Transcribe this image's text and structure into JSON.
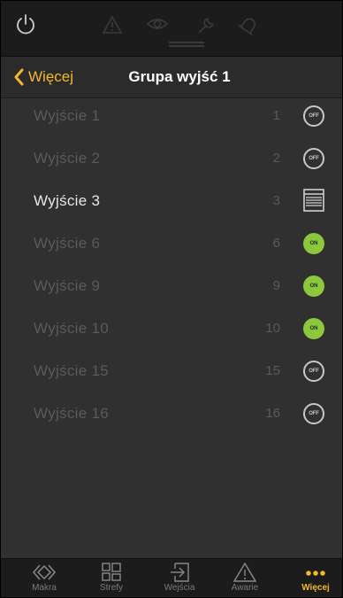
{
  "header": {
    "back_label": "Więcej",
    "title": "Grupa wyjść 1"
  },
  "outputs": [
    {
      "name": "Wyjście  1",
      "number": "1",
      "state": "OFF",
      "icon": "off-badge-icon"
    },
    {
      "name": "Wyjście  2",
      "number": "2",
      "state": "OFF",
      "icon": "off-badge-icon"
    },
    {
      "name": "Wyjście  3",
      "number": "3",
      "state": "",
      "icon": "blind-icon"
    },
    {
      "name": "Wyjście  6",
      "number": "6",
      "state": "ON",
      "icon": "on-badge-icon"
    },
    {
      "name": "Wyjście  9",
      "number": "9",
      "state": "ON",
      "icon": "on-badge-icon"
    },
    {
      "name": "Wyjście 10",
      "number": "10",
      "state": "ON",
      "icon": "on-badge-icon"
    },
    {
      "name": "Wyjście 15",
      "number": "15",
      "state": "OFF",
      "icon": "off-badge-icon"
    },
    {
      "name": "Wyjście 16",
      "number": "16",
      "state": "OFF",
      "icon": "off-badge-icon"
    }
  ],
  "tabs": [
    {
      "label": "Makra",
      "icon": "makra-icon"
    },
    {
      "label": "Strefy",
      "icon": "strefy-icon"
    },
    {
      "label": "Wejścia",
      "icon": "wejscia-icon"
    },
    {
      "label": "Awarie",
      "icon": "awarie-icon"
    },
    {
      "label": "Więcej",
      "icon": "more-dots-icon"
    }
  ],
  "colors": {
    "accent": "#f0b72f",
    "on": "#8dc63f",
    "background": "#303030",
    "bar": "#1c1c1c"
  }
}
